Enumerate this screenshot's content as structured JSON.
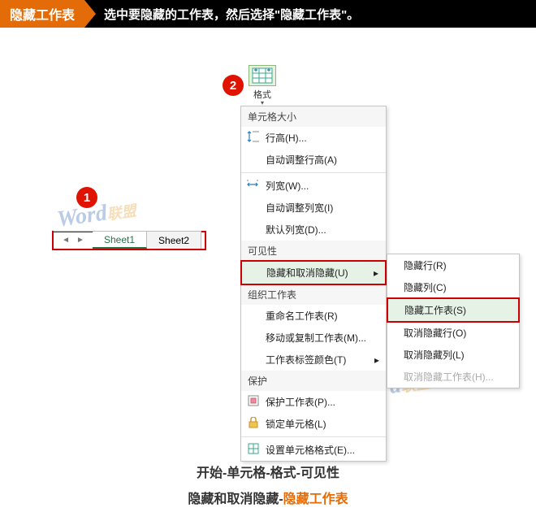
{
  "header": {
    "title": "隐藏工作表",
    "instruction": "选中要隐藏的工作表，然后选择\"隐藏工作表\"。"
  },
  "callouts": {
    "one": "1",
    "two": "2"
  },
  "sheets": {
    "tab1": "Sheet1",
    "tab2": "Sheet2",
    "scroll_left": "◄",
    "scroll_right": "►"
  },
  "watermark": {
    "part1": "Word",
    "part2": "联盟"
  },
  "ribbon": {
    "format_label": "格式",
    "caret": "▾"
  },
  "menu": {
    "section_cell_size": "单元格大小",
    "row_height": "行高(H)...",
    "autofit_row": "自动调整行高(A)",
    "col_width": "列宽(W)...",
    "autofit_col": "自动调整列宽(I)",
    "default_width": "默认列宽(D)...",
    "section_visibility": "可见性",
    "hide_unhide": "隐藏和取消隐藏(U)",
    "submenu_arrow": "▸",
    "section_org": "组织工作表",
    "rename": "重命名工作表(R)",
    "move_copy": "移动或复制工作表(M)...",
    "tab_color": "工作表标签颜色(T)",
    "section_protect": "保护",
    "protect_sheet": "保护工作表(P)...",
    "lock_cell": "锁定单元格(L)",
    "cell_format": "设置单元格格式(E)..."
  },
  "submenu": {
    "hide_row": "隐藏行(R)",
    "hide_col": "隐藏列(C)",
    "hide_sheet": "隐藏工作表(S)",
    "unhide_row": "取消隐藏行(O)",
    "unhide_col": "取消隐藏列(L)",
    "unhide_sheet": "取消隐藏工作表(H)..."
  },
  "caption": {
    "line1": "开始-单元格-格式-可见性",
    "line2_a": "隐藏和取消隐藏-",
    "line2_b": "隐藏工作表"
  }
}
